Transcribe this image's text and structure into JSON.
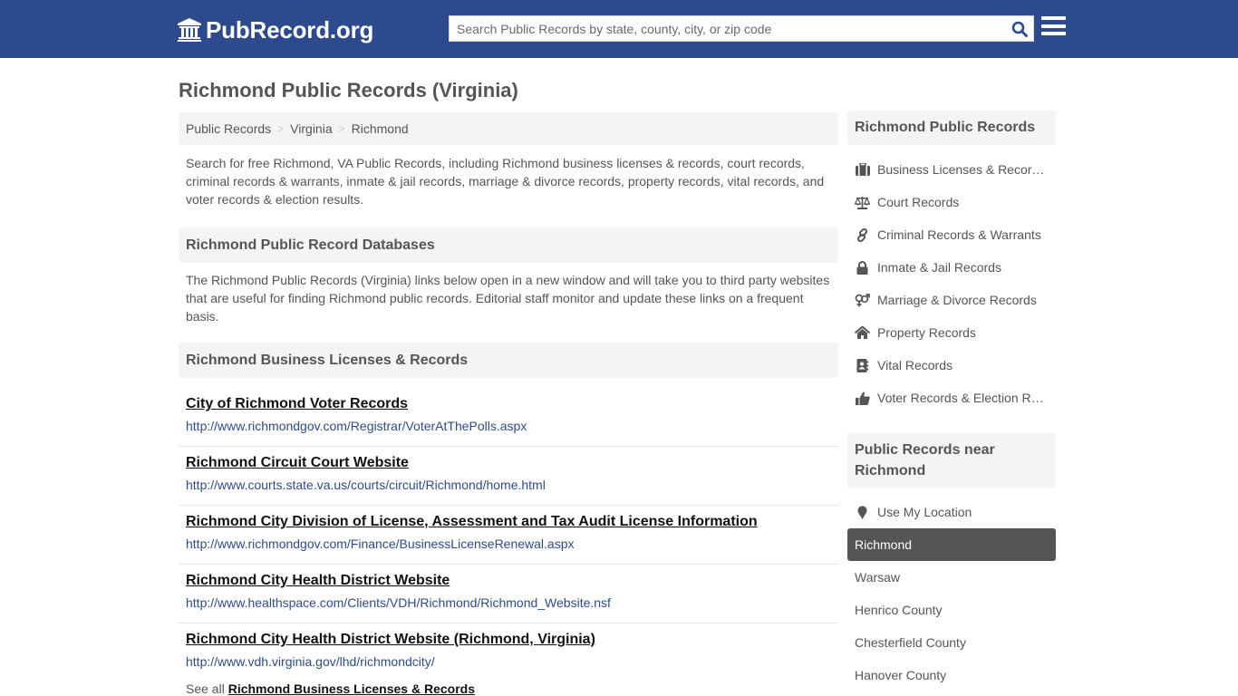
{
  "header": {
    "brand": "PubRecord.org",
    "brand_icon": "bank-building-icon",
    "search_placeholder": "Search Public Records by state, county, city, or zip code",
    "search_value": "",
    "search_icon": "search-icon",
    "menu_icon": "hamburger-menu-icon"
  },
  "colors": {
    "navbar": "#2e4a8f",
    "link_url": "#2e4a8f",
    "active_item": "#555555",
    "panel_bg": "#f4f4f4"
  },
  "page": {
    "title": "Richmond Public Records (Virginia)",
    "breadcrumb": [
      "Public Records",
      "Virginia",
      "Richmond"
    ],
    "breadcrumb_separator": ">",
    "intro": "Search for free Richmond, VA Public Records, including Richmond business licenses & records, court records, criminal records & warrants, inmate & jail records, marriage & divorce records, property records, vital records, and voter records & election results.",
    "databases_heading": "Richmond Public Record Databases",
    "databases_description": "The Richmond Public Records (Virginia) links below open in a new window and will take you to third party websites that are useful for finding Richmond public records. Editorial staff monitor and update these links on a frequent basis.",
    "business_heading": "Richmond Business Licenses & Records",
    "business_links": [
      {
        "title": "City of Richmond Voter Records",
        "url": "http://www.richmondgov.com/Registrar/VoterAtThePolls.aspx"
      },
      {
        "title": "Richmond Circuit Court Website",
        "url": "http://www.courts.state.va.us/courts/circuit/Richmond/home.html"
      },
      {
        "title": "Richmond City Division of License, Assessment and Tax Audit License Information",
        "url": "http://www.richmondgov.com/Finance/BusinessLicenseRenewal.aspx"
      },
      {
        "title": "Richmond City Health District Website",
        "url": "http://www.healthspace.com/Clients/VDH/Richmond/Richmond_Website.nsf"
      },
      {
        "title": "Richmond City Health District Website (Richmond, Virginia)",
        "url": "http://www.vdh.virginia.gov/lhd/richmondcity/"
      }
    ],
    "see_all_prefix": "See all",
    "see_all_link": "Richmond Business Licenses & Records"
  },
  "sidebar": {
    "records_heading": "Richmond Public Records",
    "record_categories": [
      {
        "label": "Business Licenses & Records",
        "icon": "briefcase-icon"
      },
      {
        "label": "Court Records",
        "icon": "scales-icon"
      },
      {
        "label": "Criminal Records & Warrants",
        "icon": "link-icon"
      },
      {
        "label": "Inmate & Jail Records",
        "icon": "lock-icon"
      },
      {
        "label": "Marriage & Divorce Records",
        "icon": "gender-icon"
      },
      {
        "label": "Property Records",
        "icon": "home-icon"
      },
      {
        "label": "Vital Records",
        "icon": "address-book-icon"
      },
      {
        "label": "Voter Records & Election Results",
        "icon": "thumbs-up-icon"
      }
    ],
    "nearby_heading": "Public Records near Richmond",
    "use_location": {
      "label": "Use My Location",
      "icon": "map-marker-icon"
    },
    "nearby_places": [
      {
        "label": "Richmond",
        "active": true
      },
      {
        "label": "Warsaw",
        "active": false
      },
      {
        "label": "Henrico County",
        "active": false
      },
      {
        "label": "Chesterfield County",
        "active": false
      },
      {
        "label": "Hanover County",
        "active": false
      }
    ]
  }
}
